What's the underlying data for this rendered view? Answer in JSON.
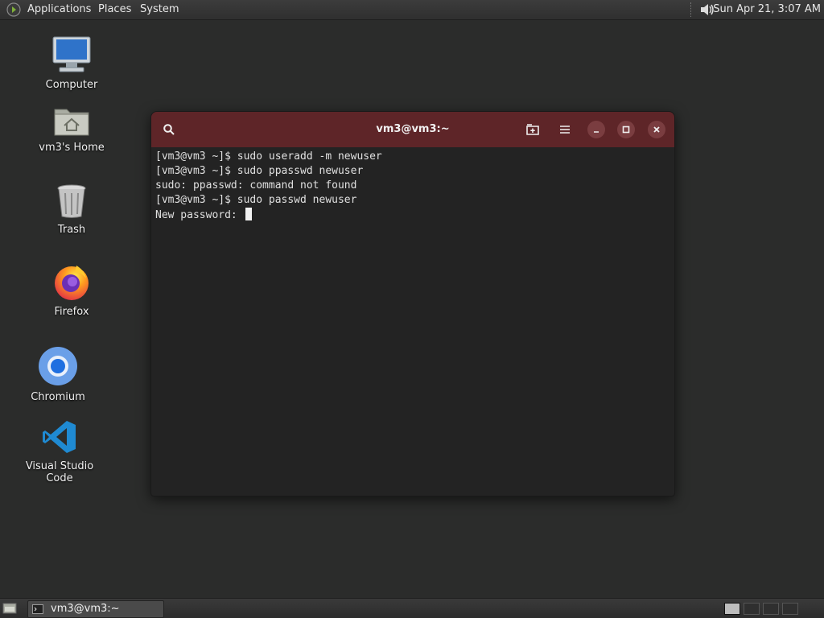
{
  "top_panel": {
    "applications": "Applications",
    "places": "Places",
    "system": "System",
    "clock": "Sun Apr 21,  3:07 AM"
  },
  "desktop": {
    "icons": [
      {
        "label": "Computer"
      },
      {
        "label": "vm3's Home"
      },
      {
        "label": "Trash"
      },
      {
        "label": "Firefox"
      },
      {
        "label": "Chromium"
      },
      {
        "label": "Visual Studio Code"
      }
    ]
  },
  "terminal": {
    "title": "vm3@vm3:~",
    "lines": [
      "[vm3@vm3 ~]$ sudo useradd -m newuser",
      "[vm3@vm3 ~]$ sudo ppasswd newuser",
      "sudo: ppasswd: command not found",
      "[vm3@vm3 ~]$ sudo passwd newuser",
      "New password: "
    ],
    "colors": {
      "header": "#5e2528",
      "background": "#232323"
    }
  },
  "bottom_panel": {
    "task_label": "vm3@vm3:~"
  }
}
